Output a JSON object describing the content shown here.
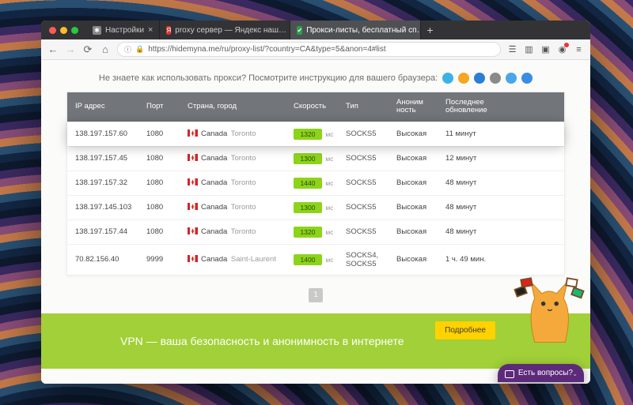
{
  "tabs": [
    {
      "label": "Настройки",
      "fav_bg": "#888",
      "fav_glyph": "✱"
    },
    {
      "label": "proxy сервер — Яндекс наш…",
      "fav_bg": "#d33",
      "fav_glyph": "Я"
    },
    {
      "label": "Прокси-листы, бесплатный сп…",
      "fav_bg": "#2a9e4f",
      "fav_glyph": "✔"
    }
  ],
  "newtab_glyph": "+",
  "url": "https://hidemyna.me/ru/proxy-list/?country=CA&type=5&anon=4#list",
  "instruction": "Не знаете как использовать прокси? Посмотрите инструкцию для вашего браузера:",
  "headers": {
    "ip": "IP адрес",
    "port": "Порт",
    "country": "Страна, город",
    "speed": "Скорость",
    "type": "Тип",
    "anon": "Аноним ность",
    "updated": "Последнее обновление"
  },
  "rows": [
    {
      "ip": "138.197.157.60",
      "port": "1080",
      "country": "Canada",
      "city": "Toronto",
      "speed": "1320",
      "type": "SOCKS5",
      "anon": "Высокая",
      "updated": "11 минут",
      "highlight": true
    },
    {
      "ip": "138.197.157.45",
      "port": "1080",
      "country": "Canada",
      "city": "Toronto",
      "speed": "1300",
      "type": "SOCKS5",
      "anon": "Высокая",
      "updated": "12 минут",
      "highlight": false
    },
    {
      "ip": "138.197.157.32",
      "port": "1080",
      "country": "Canada",
      "city": "Toronto",
      "speed": "1440",
      "type": "SOCKS5",
      "anon": "Высокая",
      "updated": "48 минут",
      "highlight": false
    },
    {
      "ip": "138.197.145.103",
      "port": "1080",
      "country": "Canada",
      "city": "Toronto",
      "speed": "1300",
      "type": "SOCKS5",
      "anon": "Высокая",
      "updated": "48 минут",
      "highlight": false
    },
    {
      "ip": "138.197.157.44",
      "port": "1080",
      "country": "Canada",
      "city": "Toronto",
      "speed": "1320",
      "type": "SOCKS5",
      "anon": "Высокая",
      "updated": "48 минут",
      "highlight": false
    },
    {
      "ip": "70.82.156.40",
      "port": "9999",
      "country": "Canada",
      "city": "Saint-Laurent",
      "speed": "1400",
      "type": "SOCKS4, SOCKS5",
      "anon": "Высокая",
      "updated": "1 ч. 49 мин.",
      "highlight": false
    }
  ],
  "ms_suffix": "мс",
  "pager": "1",
  "vpn_text": "VPN — ваша безопасность и анонимность в интернете",
  "vpn_button": "Подробнее",
  "chat_text": "Есть вопросы?"
}
